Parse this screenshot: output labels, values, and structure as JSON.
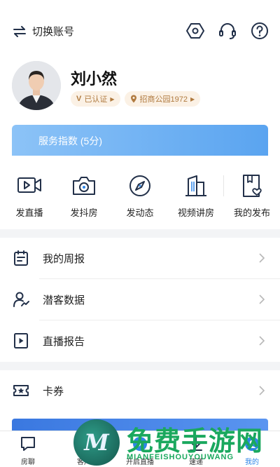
{
  "header": {
    "switch_label": "切换账号",
    "icons": [
      "settings-hexagon-icon",
      "customer-service-headset-icon",
      "help-icon"
    ]
  },
  "profile": {
    "name": "刘小然",
    "verified_label": "已认证",
    "location_label": "招商公园1972"
  },
  "service_card": {
    "label": "服务指数 (5分)"
  },
  "quick_actions": [
    {
      "label": "发直播",
      "icon": "live-video-icon"
    },
    {
      "label": "发抖房",
      "icon": "camera-icon"
    },
    {
      "label": "发动态",
      "icon": "compass-icon"
    },
    {
      "label": "视频讲房",
      "icon": "building-icon"
    },
    {
      "label": "我的发布",
      "icon": "publish-book-icon"
    }
  ],
  "menu": [
    {
      "label": "我的周报",
      "icon": "calendar-icon"
    },
    {
      "label": "潜客数据",
      "icon": "user-trend-icon"
    },
    {
      "label": "直播报告",
      "icon": "play-report-icon"
    },
    {
      "label": "卡券",
      "icon": "coupon-star-icon"
    }
  ],
  "tabbar": [
    {
      "label": "房聊",
      "icon": "chat-icon",
      "active": false
    },
    {
      "label": "客户",
      "icon": "customer-icon",
      "active": false
    },
    {
      "label": "开启直播",
      "icon": "live-icon",
      "active": false
    },
    {
      "label": "速递",
      "icon": "express-icon",
      "active": false
    },
    {
      "label": "我的",
      "icon": "me-icon",
      "active": true
    }
  ],
  "watermark": {
    "logo_letter": "M",
    "title": "免费手游网",
    "subtitle": "MIANFEISHOUYOUWANG"
  },
  "colors": {
    "accent": "#2e86e8",
    "badge_bg": "#fbf1e5",
    "badge_text": "#b07a3f",
    "icon_stroke": "#223049",
    "watermark_green": "#1aa85e"
  }
}
